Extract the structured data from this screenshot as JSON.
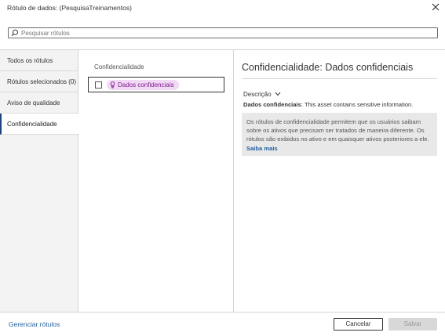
{
  "dialog": {
    "title": "Rótulo de dados: (PesquisaTreinamentos)"
  },
  "search": {
    "placeholder": "Pesquisar rótulos",
    "value": ""
  },
  "sidebar": {
    "items": [
      {
        "label": "Todos os rótulos",
        "selected": false
      },
      {
        "label": "Rótulos selecionados (0)",
        "selected": false
      },
      {
        "label": "Aviso de qualidade",
        "selected": false
      },
      {
        "label": "Confidencialidade",
        "selected": true
      }
    ]
  },
  "list": {
    "heading": "Confidencialidade",
    "items": [
      {
        "label": "Dados confidenciais",
        "checked": false,
        "icon": "lightbulb-icon"
      }
    ]
  },
  "detail": {
    "title": "Confidencialidade: Dados confidenciais",
    "description_toggle": "Descrição",
    "description_name": "Dados confidenciais",
    "description_text": ": This asset contains sensitive information.",
    "info_line1": "Os rótulos de confidencialidade permitem que os usuários saibam",
    "info_line2": "sobre os ativos que precisam ser tratados de maneira diferente. Os",
    "info_line3": "rótulos são exibidos no ativo e em quaisquer ativos posteriores a ele.",
    "learn_more": "Saiba mais"
  },
  "footer": {
    "manage_link": "Gerenciar rótulos",
    "cancel_label": "Cancelar",
    "save_label": "Salvar"
  },
  "colors": {
    "accent": "#1f457e",
    "link": "#1f5f9e",
    "pill_bg": "#f2d9f5",
    "pill_text": "#7a1e8c"
  }
}
